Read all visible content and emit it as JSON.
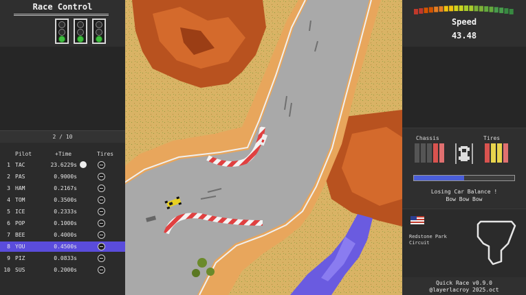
{
  "race_control": {
    "title": "Race Control",
    "start_lights": [
      {
        "state": "green"
      },
      {
        "state": "green"
      },
      {
        "state": "green"
      }
    ]
  },
  "lap": {
    "text": "2 / 10",
    "current": 2,
    "total": 10
  },
  "standings": {
    "headers": {
      "pilot": "Pilot",
      "time": "+Time",
      "tires": "Tires"
    },
    "rows": [
      {
        "pos": "1",
        "pilot": "TAC",
        "time": "23.6229s",
        "leader": true
      },
      {
        "pos": "2",
        "pilot": "PAS",
        "time": "0.9000s"
      },
      {
        "pos": "3",
        "pilot": "HAM",
        "time": "0.2167s"
      },
      {
        "pos": "4",
        "pilot": "TOM",
        "time": "0.3500s"
      },
      {
        "pos": "5",
        "pilot": "ICE",
        "time": "0.2333s"
      },
      {
        "pos": "6",
        "pilot": "POP",
        "time": "0.1000s"
      },
      {
        "pos": "7",
        "pilot": "BEE",
        "time": "0.4000s"
      },
      {
        "pos": "8",
        "pilot": "YOU",
        "time": "0.4500s",
        "highlight": true
      },
      {
        "pos": "9",
        "pilot": "PIZ",
        "time": "0.0833s"
      },
      {
        "pos": "10",
        "pilot": "SUS",
        "time": "0.2000s"
      }
    ]
  },
  "speed": {
    "label": "Speed",
    "value": "43.48",
    "gauge_level": 0.6
  },
  "car_status": {
    "chassis_label": "Chassis",
    "tires_label": "Tires",
    "chassis_bars": [
      "#555555",
      "#555555",
      "#555555",
      "#d9534f",
      "#e07070"
    ],
    "tire_bars": [
      "#d9534f",
      "#e8d44d",
      "#e8d44d",
      "#e07070"
    ],
    "balance_level": 0.5,
    "message_line1": "Losing Car Balance !",
    "message_line2": "Bow Bow Bow"
  },
  "circuit": {
    "flag": "usa-flag",
    "name": "Redstone Park Circuit"
  },
  "footer": {
    "version": "Quick Race v0.9.0",
    "credit": "@layerlacroy 2025.oct"
  },
  "colors": {
    "highlight": "#5a4cdc",
    "asphalt": "#a9a9a9",
    "sand": "#d9b365",
    "rock": "#b8521f",
    "water": "#6a5be0"
  }
}
